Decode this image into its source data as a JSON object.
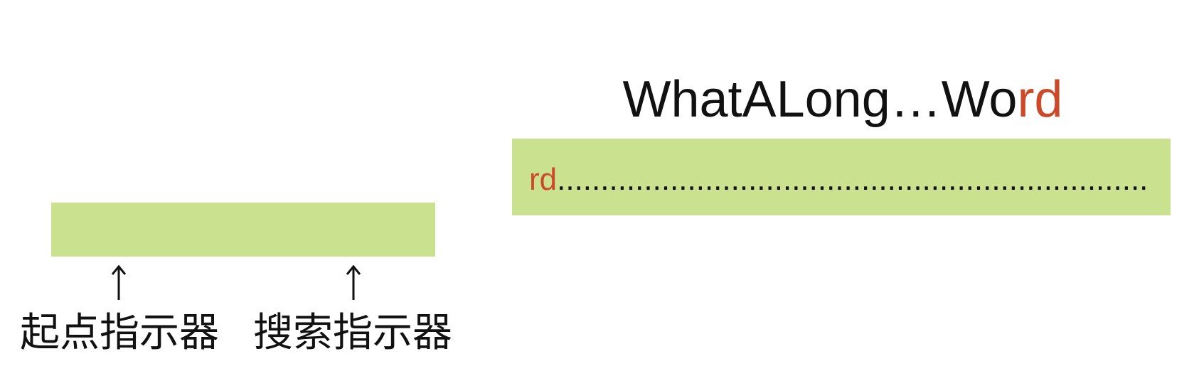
{
  "left_diagram": {
    "start_pointer_label": "起点指示器",
    "search_pointer_label": "搜索指示器",
    "pointer_glyph": "↑"
  },
  "right_diagram": {
    "title_prefix": "WhatALong…Wo",
    "title_highlight": "rd",
    "buffer_highlight": "rd",
    "buffer_rest": "...................................................................."
  },
  "colors": {
    "bar": "#cae190",
    "accent": "#cc4a2a",
    "text": "#111111"
  }
}
